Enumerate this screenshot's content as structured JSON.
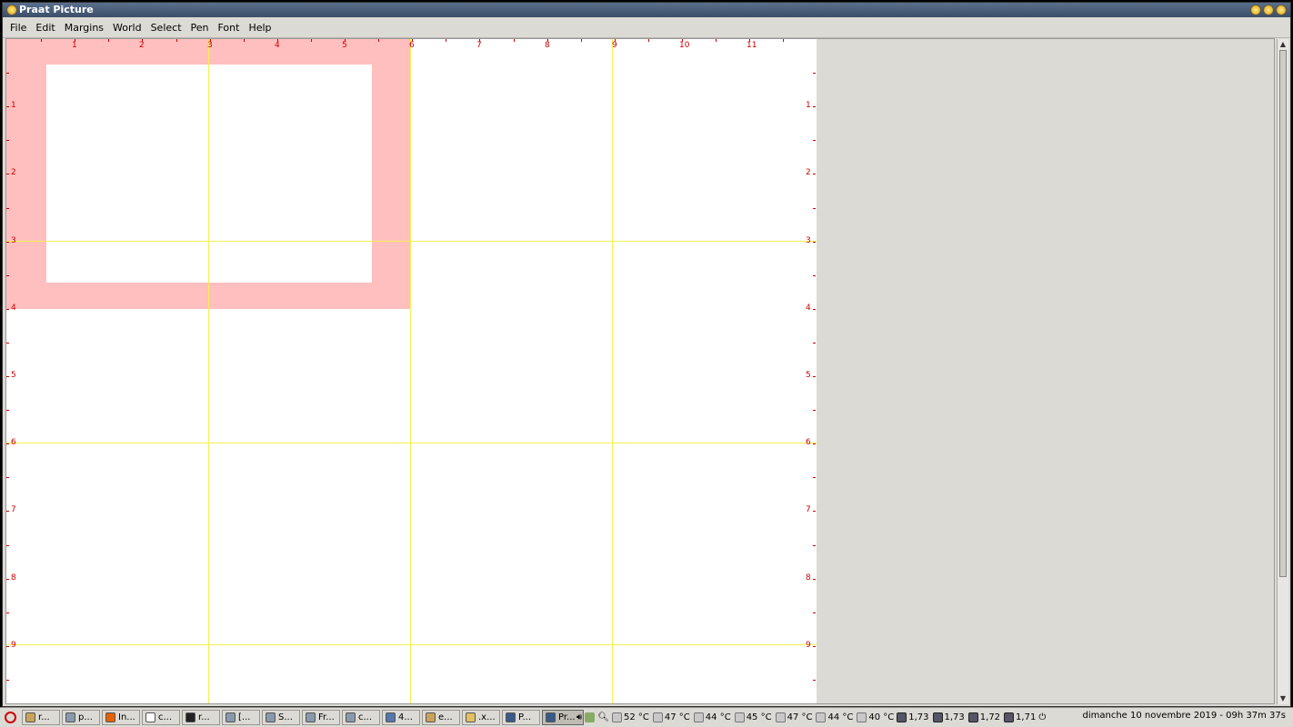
{
  "window": {
    "title": "Praat Picture"
  },
  "menu": [
    "File",
    "Edit",
    "Margins",
    "World",
    "Select",
    "Pen",
    "Font",
    "Help"
  ],
  "ruler": {
    "x_labels": [
      "1",
      "2",
      "3",
      "4",
      "5",
      "6",
      "7",
      "8",
      "9",
      "10",
      "11"
    ],
    "y_labels_left": [
      "1",
      "2",
      "3",
      "4",
      "5",
      "6",
      "7",
      "8",
      "9"
    ],
    "y_labels_right": [
      "1",
      "2",
      "3",
      "4",
      "5",
      "6",
      "7",
      "8",
      "9"
    ]
  },
  "taskbar": {
    "tasks": [
      {
        "label": "r...",
        "icon": "folder-icon"
      },
      {
        "label": "p...",
        "icon": "app-icon"
      },
      {
        "label": "In...",
        "icon": "firefox-icon"
      },
      {
        "label": "c...",
        "icon": "document-icon"
      },
      {
        "label": "r...",
        "icon": "terminal-icon"
      },
      {
        "label": "[...",
        "icon": "app-icon"
      },
      {
        "label": "S...",
        "icon": "app-icon"
      },
      {
        "label": "Fr...",
        "icon": "app-icon"
      },
      {
        "label": "c...",
        "icon": "app-icon"
      },
      {
        "label": "4...",
        "icon": "magnifier-icon"
      },
      {
        "label": "e...",
        "icon": "folder-icon"
      },
      {
        "label": ".x...",
        "icon": "editor-icon"
      },
      {
        "label": "P...",
        "icon": "window-icon"
      },
      {
        "label": "Pr...",
        "icon": "window-icon",
        "active": true
      }
    ],
    "temps": [
      "52 °C",
      "47 °C",
      "44 °C",
      "45 °C",
      "47 °C",
      "44 °C",
      "40 °C"
    ],
    "freqs": [
      "1,73",
      "1,73",
      "1,72",
      "1,71"
    ],
    "clock": "dimanche 10 novembre 2019 - 09h 37m 37s"
  }
}
